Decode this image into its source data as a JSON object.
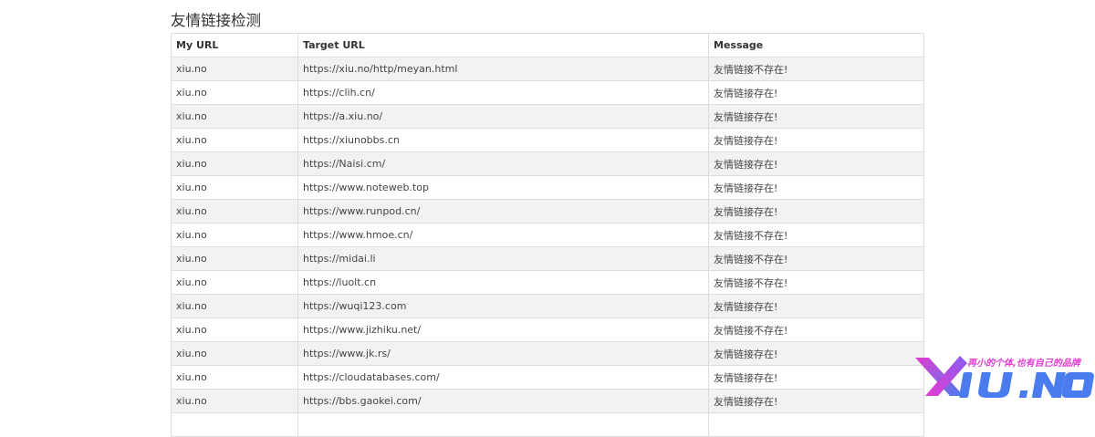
{
  "page": {
    "title": "友情链接检测"
  },
  "table": {
    "headers": [
      "My URL",
      "Target URL",
      "Message"
    ],
    "rows": [
      {
        "my_url": "xiu.no",
        "target_url": "https://xiu.no/http/meyan.html",
        "message": "友情链接不存在!"
      },
      {
        "my_url": "xiu.no",
        "target_url": "https://clih.cn/",
        "message": "友情链接存在!"
      },
      {
        "my_url": "xiu.no",
        "target_url": "https://a.xiu.no/",
        "message": "友情链接存在!"
      },
      {
        "my_url": "xiu.no",
        "target_url": "https://xiunobbs.cn",
        "message": "友情链接存在!"
      },
      {
        "my_url": "xiu.no",
        "target_url": "https://Naisi.cm/",
        "message": "友情链接存在!"
      },
      {
        "my_url": "xiu.no",
        "target_url": "https://www.noteweb.top",
        "message": "友情链接存在!"
      },
      {
        "my_url": "xiu.no",
        "target_url": "https://www.runpod.cn/",
        "message": "友情链接存在!"
      },
      {
        "my_url": "xiu.no",
        "target_url": "https://www.hmoe.cn/",
        "message": "友情链接不存在!"
      },
      {
        "my_url": "xiu.no",
        "target_url": "https://midai.li",
        "message": "友情链接不存在!"
      },
      {
        "my_url": "xiu.no",
        "target_url": "https://luolt.cn",
        "message": "友情链接不存在!"
      },
      {
        "my_url": "xiu.no",
        "target_url": "https://wuqi123.com",
        "message": "友情链接存在!"
      },
      {
        "my_url": "xiu.no",
        "target_url": "https://www.jizhiku.net/",
        "message": "友情链接不存在!"
      },
      {
        "my_url": "xiu.no",
        "target_url": "https://www.jk.rs/",
        "message": "友情链接存在!"
      },
      {
        "my_url": "xiu.no",
        "target_url": "https://cloudatabases.com/",
        "message": "友情链接存在!"
      },
      {
        "my_url": "xiu.no",
        "target_url": "https://bbs.gaokei.com/",
        "message": "友情链接存在!"
      },
      {
        "my_url": "",
        "target_url": "",
        "message": ""
      }
    ]
  },
  "watermark": {
    "slogan": "再小的个体,也有自己的品牌",
    "brand": "XiU.NO",
    "colors": {
      "pink": "#e23cd0",
      "blue": "#4a7cf0",
      "purple": "#8a5cf0"
    }
  }
}
